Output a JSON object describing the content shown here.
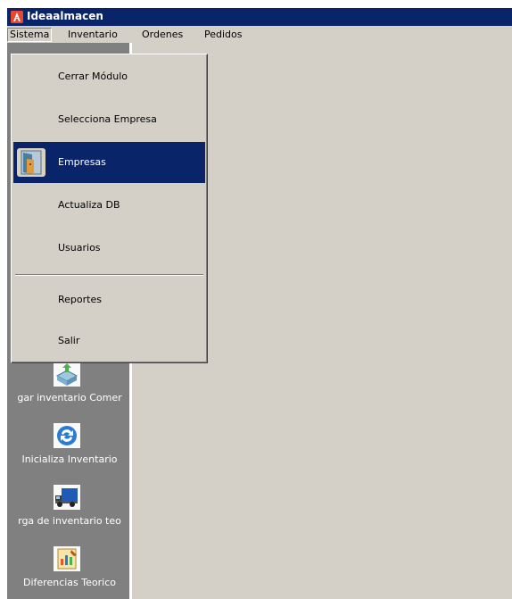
{
  "window": {
    "title": "Ideaalmacen",
    "titlebar_color": "#0a246a",
    "bg_color": "#d4d0c8"
  },
  "menubar": {
    "items": [
      {
        "label": "Sistema",
        "active": true
      },
      {
        "label": "Inventario"
      },
      {
        "label": "Ordenes"
      },
      {
        "label": "Pedidos"
      }
    ]
  },
  "sistema_menu": {
    "items": [
      {
        "label": "Cerrar Módulo"
      },
      {
        "label": "Selecciona Empresa"
      },
      {
        "label": "Empresas",
        "icon": "door-icon",
        "highlighted": true
      },
      {
        "label": "Actualiza DB"
      },
      {
        "label": "Usuarios"
      },
      {
        "label": "Reportes"
      },
      {
        "label": "Salir"
      }
    ],
    "highlight_color": "#0a246a"
  },
  "sidebar": {
    "bg_color": "#808080",
    "items": [
      {
        "label": "gar inventario Comer",
        "icon": "upload-box-icon"
      },
      {
        "label": "Inicializa Inventario",
        "icon": "refresh-icon"
      },
      {
        "label": "rga de inventario teo",
        "icon": "truck-icon"
      },
      {
        "label": "Diferencias Teorico",
        "icon": "report-chart-icon"
      }
    ]
  }
}
